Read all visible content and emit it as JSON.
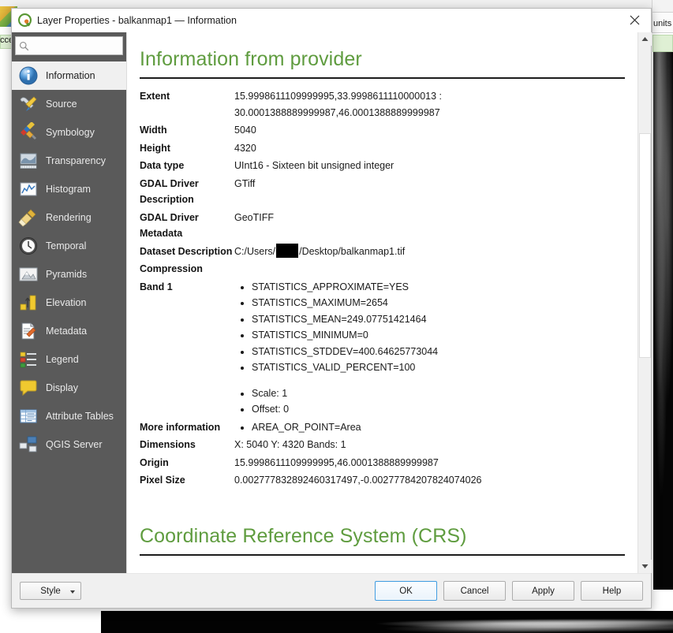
{
  "background": {
    "label_left": "cce",
    "label_right": "units"
  },
  "dialog": {
    "title": "Layer Properties - balkanmap1 — Information",
    "logo_icon": "qgis-logo-icon",
    "close_icon": "close-icon"
  },
  "sidebar": {
    "search": {
      "value": "",
      "placeholder": "",
      "icon": "search-icon"
    },
    "items": [
      {
        "label": "Information",
        "icon": "information-icon",
        "selected": true
      },
      {
        "label": "Source",
        "icon": "source-icon",
        "selected": false
      },
      {
        "label": "Symbology",
        "icon": "symbology-icon",
        "selected": false
      },
      {
        "label": "Transparency",
        "icon": "transparency-icon",
        "selected": false
      },
      {
        "label": "Histogram",
        "icon": "histogram-icon",
        "selected": false
      },
      {
        "label": "Rendering",
        "icon": "rendering-icon",
        "selected": false
      },
      {
        "label": "Temporal",
        "icon": "temporal-icon",
        "selected": false
      },
      {
        "label": "Pyramids",
        "icon": "pyramids-icon",
        "selected": false
      },
      {
        "label": "Elevation",
        "icon": "elevation-icon",
        "selected": false
      },
      {
        "label": "Metadata",
        "icon": "metadata-icon",
        "selected": false
      },
      {
        "label": "Legend",
        "icon": "legend-icon",
        "selected": false
      },
      {
        "label": "Display",
        "icon": "display-icon",
        "selected": false
      },
      {
        "label": "Attribute Tables",
        "icon": "attribute-tables-icon",
        "selected": false
      },
      {
        "label": "QGIS Server",
        "icon": "qgis-server-icon",
        "selected": false
      }
    ]
  },
  "content": {
    "heading_provider": "Information from provider",
    "heading_crs": "Coordinate Reference System (CRS)",
    "rows": {
      "extent_key": "Extent",
      "extent_line1": "15.9998611109999995,33.9998611110000013 :",
      "extent_line2": "30.0001388889999987,46.0001388889999987",
      "width_key": "Width",
      "width_value": "5040",
      "height_key": "Height",
      "height_value": "4320",
      "datatype_key": "Data type",
      "datatype_value": "UInt16 - Sixteen bit unsigned integer",
      "gdal_driver_desc_key": "GDAL Driver Description",
      "gdal_driver_desc_value": "GTiff",
      "gdal_driver_meta_key": "GDAL Driver Metadata",
      "gdal_driver_meta_value": "GeoTIFF",
      "dataset_key": "Dataset Description",
      "dataset_value_prefix": "C:/Users/",
      "dataset_value_suffix": "/Desktop/balkanmap1.tif",
      "compression_key": "Compression",
      "compression_value": "",
      "band1_key": "Band 1",
      "band1_stats": [
        "STATISTICS_APPROXIMATE=YES",
        "STATISTICS_MAXIMUM=2654",
        "STATISTICS_MEAN=249.07751421464",
        "STATISTICS_MINIMUM=0",
        "STATISTICS_STDDEV=400.64625773044",
        "STATISTICS_VALID_PERCENT=100"
      ],
      "band1_extra": [
        "Scale: 1",
        "Offset: 0"
      ],
      "more_info_key": "More information",
      "more_info_items": [
        "AREA_OR_POINT=Area"
      ],
      "dimensions_key": "Dimensions",
      "dimensions_value": "X: 5040 Y: 4320 Bands: 1",
      "origin_key": "Origin",
      "origin_value": "15.9998611109999995,46.0001388889999987",
      "pixelsize_key": "Pixel Size",
      "pixelsize_value": "0.002777832892460317497,-0.00277784207824074026"
    }
  },
  "footer": {
    "style_label": "Style",
    "ok_label": "OK",
    "cancel_label": "Cancel",
    "apply_label": "Apply",
    "help_label": "Help"
  },
  "colors": {
    "heading_green": "#5f9c3f",
    "sidebar_bg": "#5a5a5a",
    "default_button_border": "#3c9ae0"
  }
}
